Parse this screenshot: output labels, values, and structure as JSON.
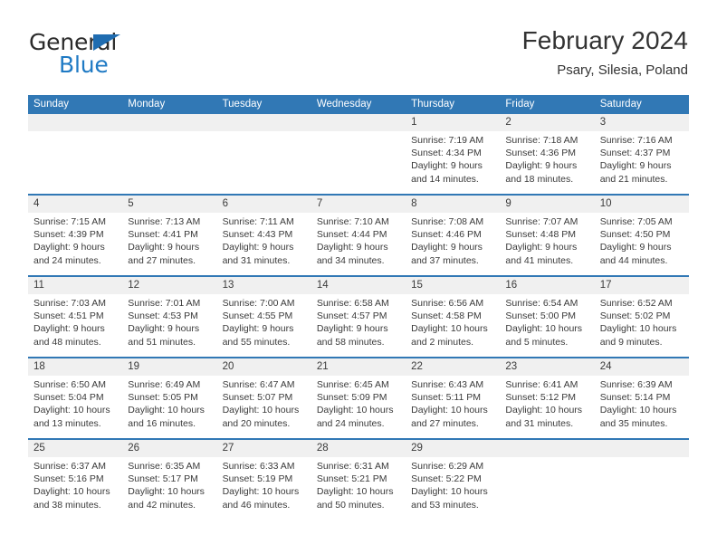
{
  "brand": {
    "name_top": "General",
    "name_bottom": "Blue",
    "triangle_color": "#1f6cb0",
    "blue_color": "#1f7ac4"
  },
  "header": {
    "title": "February 2024",
    "subtitle": "Psary, Silesia, Poland"
  },
  "theme": {
    "header_blue": "#3178b5",
    "date_band_gray": "#f0f0f0",
    "text_color": "#3a3a3a"
  },
  "weekdays": [
    "Sunday",
    "Monday",
    "Tuesday",
    "Wednesday",
    "Thursday",
    "Friday",
    "Saturday"
  ],
  "weeks": [
    {
      "days": [
        {
          "date": "",
          "lines": [
            "",
            "",
            "",
            ""
          ]
        },
        {
          "date": "",
          "lines": [
            "",
            "",
            "",
            ""
          ]
        },
        {
          "date": "",
          "lines": [
            "",
            "",
            "",
            ""
          ]
        },
        {
          "date": "",
          "lines": [
            "",
            "",
            "",
            ""
          ]
        },
        {
          "date": "1",
          "lines": [
            "Sunrise: 7:19 AM",
            "Sunset: 4:34 PM",
            "Daylight: 9 hours",
            "and 14 minutes."
          ]
        },
        {
          "date": "2",
          "lines": [
            "Sunrise: 7:18 AM",
            "Sunset: 4:36 PM",
            "Daylight: 9 hours",
            "and 18 minutes."
          ]
        },
        {
          "date": "3",
          "lines": [
            "Sunrise: 7:16 AM",
            "Sunset: 4:37 PM",
            "Daylight: 9 hours",
            "and 21 minutes."
          ]
        }
      ]
    },
    {
      "days": [
        {
          "date": "4",
          "lines": [
            "Sunrise: 7:15 AM",
            "Sunset: 4:39 PM",
            "Daylight: 9 hours",
            "and 24 minutes."
          ]
        },
        {
          "date": "5",
          "lines": [
            "Sunrise: 7:13 AM",
            "Sunset: 4:41 PM",
            "Daylight: 9 hours",
            "and 27 minutes."
          ]
        },
        {
          "date": "6",
          "lines": [
            "Sunrise: 7:11 AM",
            "Sunset: 4:43 PM",
            "Daylight: 9 hours",
            "and 31 minutes."
          ]
        },
        {
          "date": "7",
          "lines": [
            "Sunrise: 7:10 AM",
            "Sunset: 4:44 PM",
            "Daylight: 9 hours",
            "and 34 minutes."
          ]
        },
        {
          "date": "8",
          "lines": [
            "Sunrise: 7:08 AM",
            "Sunset: 4:46 PM",
            "Daylight: 9 hours",
            "and 37 minutes."
          ]
        },
        {
          "date": "9",
          "lines": [
            "Sunrise: 7:07 AM",
            "Sunset: 4:48 PM",
            "Daylight: 9 hours",
            "and 41 minutes."
          ]
        },
        {
          "date": "10",
          "lines": [
            "Sunrise: 7:05 AM",
            "Sunset: 4:50 PM",
            "Daylight: 9 hours",
            "and 44 minutes."
          ]
        }
      ]
    },
    {
      "days": [
        {
          "date": "11",
          "lines": [
            "Sunrise: 7:03 AM",
            "Sunset: 4:51 PM",
            "Daylight: 9 hours",
            "and 48 minutes."
          ]
        },
        {
          "date": "12",
          "lines": [
            "Sunrise: 7:01 AM",
            "Sunset: 4:53 PM",
            "Daylight: 9 hours",
            "and 51 minutes."
          ]
        },
        {
          "date": "13",
          "lines": [
            "Sunrise: 7:00 AM",
            "Sunset: 4:55 PM",
            "Daylight: 9 hours",
            "and 55 minutes."
          ]
        },
        {
          "date": "14",
          "lines": [
            "Sunrise: 6:58 AM",
            "Sunset: 4:57 PM",
            "Daylight: 9 hours",
            "and 58 minutes."
          ]
        },
        {
          "date": "15",
          "lines": [
            "Sunrise: 6:56 AM",
            "Sunset: 4:58 PM",
            "Daylight: 10 hours",
            "and 2 minutes."
          ]
        },
        {
          "date": "16",
          "lines": [
            "Sunrise: 6:54 AM",
            "Sunset: 5:00 PM",
            "Daylight: 10 hours",
            "and 5 minutes."
          ]
        },
        {
          "date": "17",
          "lines": [
            "Sunrise: 6:52 AM",
            "Sunset: 5:02 PM",
            "Daylight: 10 hours",
            "and 9 minutes."
          ]
        }
      ]
    },
    {
      "days": [
        {
          "date": "18",
          "lines": [
            "Sunrise: 6:50 AM",
            "Sunset: 5:04 PM",
            "Daylight: 10 hours",
            "and 13 minutes."
          ]
        },
        {
          "date": "19",
          "lines": [
            "Sunrise: 6:49 AM",
            "Sunset: 5:05 PM",
            "Daylight: 10 hours",
            "and 16 minutes."
          ]
        },
        {
          "date": "20",
          "lines": [
            "Sunrise: 6:47 AM",
            "Sunset: 5:07 PM",
            "Daylight: 10 hours",
            "and 20 minutes."
          ]
        },
        {
          "date": "21",
          "lines": [
            "Sunrise: 6:45 AM",
            "Sunset: 5:09 PM",
            "Daylight: 10 hours",
            "and 24 minutes."
          ]
        },
        {
          "date": "22",
          "lines": [
            "Sunrise: 6:43 AM",
            "Sunset: 5:11 PM",
            "Daylight: 10 hours",
            "and 27 minutes."
          ]
        },
        {
          "date": "23",
          "lines": [
            "Sunrise: 6:41 AM",
            "Sunset: 5:12 PM",
            "Daylight: 10 hours",
            "and 31 minutes."
          ]
        },
        {
          "date": "24",
          "lines": [
            "Sunrise: 6:39 AM",
            "Sunset: 5:14 PM",
            "Daylight: 10 hours",
            "and 35 minutes."
          ]
        }
      ]
    },
    {
      "days": [
        {
          "date": "25",
          "lines": [
            "Sunrise: 6:37 AM",
            "Sunset: 5:16 PM",
            "Daylight: 10 hours",
            "and 38 minutes."
          ]
        },
        {
          "date": "26",
          "lines": [
            "Sunrise: 6:35 AM",
            "Sunset: 5:17 PM",
            "Daylight: 10 hours",
            "and 42 minutes."
          ]
        },
        {
          "date": "27",
          "lines": [
            "Sunrise: 6:33 AM",
            "Sunset: 5:19 PM",
            "Daylight: 10 hours",
            "and 46 minutes."
          ]
        },
        {
          "date": "28",
          "lines": [
            "Sunrise: 6:31 AM",
            "Sunset: 5:21 PM",
            "Daylight: 10 hours",
            "and 50 minutes."
          ]
        },
        {
          "date": "29",
          "lines": [
            "Sunrise: 6:29 AM",
            "Sunset: 5:22 PM",
            "Daylight: 10 hours",
            "and 53 minutes."
          ]
        },
        {
          "date": "",
          "lines": [
            "",
            "",
            "",
            ""
          ]
        },
        {
          "date": "",
          "lines": [
            "",
            "",
            "",
            ""
          ]
        }
      ]
    }
  ]
}
